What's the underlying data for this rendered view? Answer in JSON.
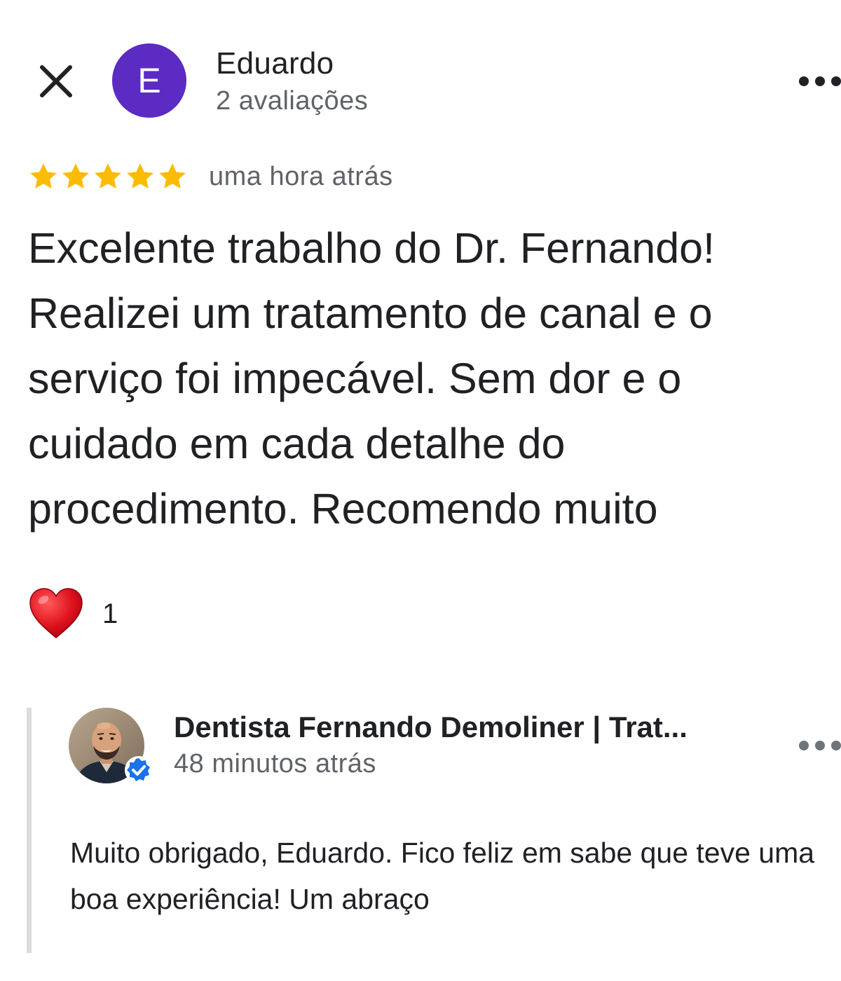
{
  "review": {
    "reviewer": {
      "initial": "E",
      "name": "Eduardo",
      "meta": "2 avaliações",
      "avatar_color": "#5b2bc4"
    },
    "rating": 5,
    "rating_max": 5,
    "star_color": "#fbbc04",
    "time_ago": "uma hora atrás",
    "text": "Excelente trabalho do Dr. Fernando! Realizei um tratamento de canal e o serviço foi impecável. Sem dor e o cuidado em cada detalhe do procedimento. Recomendo muito",
    "reaction": {
      "icon": "heart-icon",
      "count": "1"
    }
  },
  "owner_reply": {
    "name": "Dentista Fernando Demoliner | Trat...",
    "verified": true,
    "verified_color": "#1a73e8",
    "time_ago": "48 minutos atrás",
    "text": "Muito obrigado, Eduardo. Fico feliz em sabe que teve uma boa experiência! Um abraço"
  },
  "icons": {
    "close": "close-icon",
    "more": "more-options-icon"
  }
}
